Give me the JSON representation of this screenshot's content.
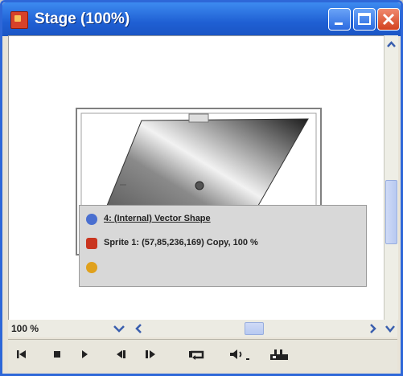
{
  "window": {
    "title": "Stage (100%)"
  },
  "stage_info": [
    {
      "icon": "vector-shape-icon",
      "text": "4: (Internal) Vector Shape"
    },
    {
      "icon": "sprite-icon",
      "text": "Sprite 1: (57,85,236,169) Copy, 100 %"
    },
    {
      "icon": "behavior-icon",
      "text": ""
    }
  ],
  "zoom": {
    "value": "100 %"
  },
  "colors": {
    "titlebar": "#1f5fd3",
    "close": "#d2421f"
  }
}
